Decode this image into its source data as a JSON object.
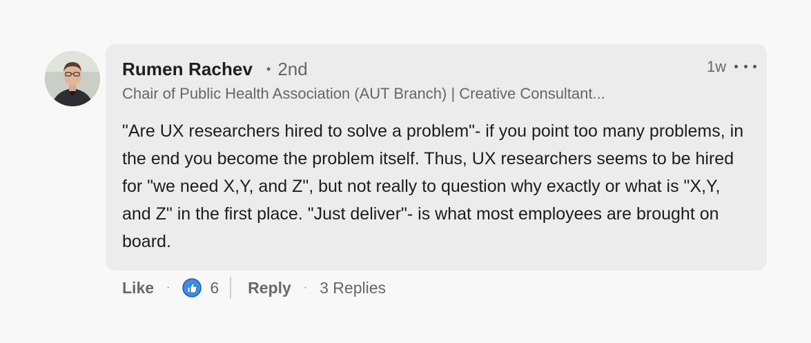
{
  "comment": {
    "author": "Rumen Rachev",
    "degree_separator": "•",
    "degree": "2nd",
    "headline": "Chair of Public Health Association (AUT Branch) | Creative Consultant...",
    "timestamp": "1w",
    "text": "\"Are UX researchers hired to solve a problem\"- if you point too many problems, in the end you become the problem itself. Thus, UX researchers seems to be hired for \"we need X,Y, and Z\", but not really to question why exactly or what is \"X,Y, and Z\" in the first place. \"Just deliver\"- is what most employees are brought on board."
  },
  "actions": {
    "like_label": "Like",
    "dot": "·",
    "reaction_icon": "thumbs-up-icon",
    "reaction_count": "6",
    "reply_label": "Reply",
    "replies_label": "3 Replies"
  },
  "colors": {
    "background": "#f8f8f8",
    "bubble": "#ececec",
    "like_reaction": "#378fe9"
  }
}
